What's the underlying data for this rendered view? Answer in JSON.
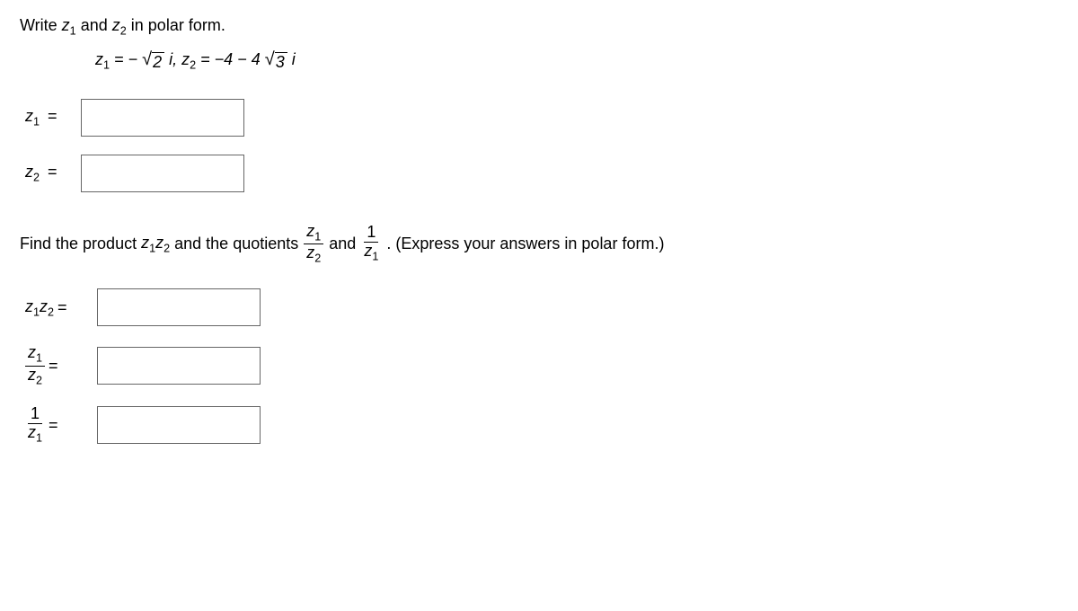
{
  "prompt1_a": "Write ",
  "prompt1_b": " and ",
  "prompt1_c": " in polar form.",
  "z1_label": "z",
  "sub1": "1",
  "z2_label": "z",
  "sub2": "2",
  "given_eq_a": " = −",
  "given_rad1": "2",
  "given_i1": "i,  ",
  "given_eq_b": " = −4 − 4",
  "given_rad2": "3",
  "given_i2": "i",
  "eq_sign": "=",
  "prompt2_a": "Find the product ",
  "prompt2_b": " and the quotients ",
  "prompt2_c": " and ",
  "prompt2_d": ".  (Express your answers in polar form.)",
  "one": "1"
}
